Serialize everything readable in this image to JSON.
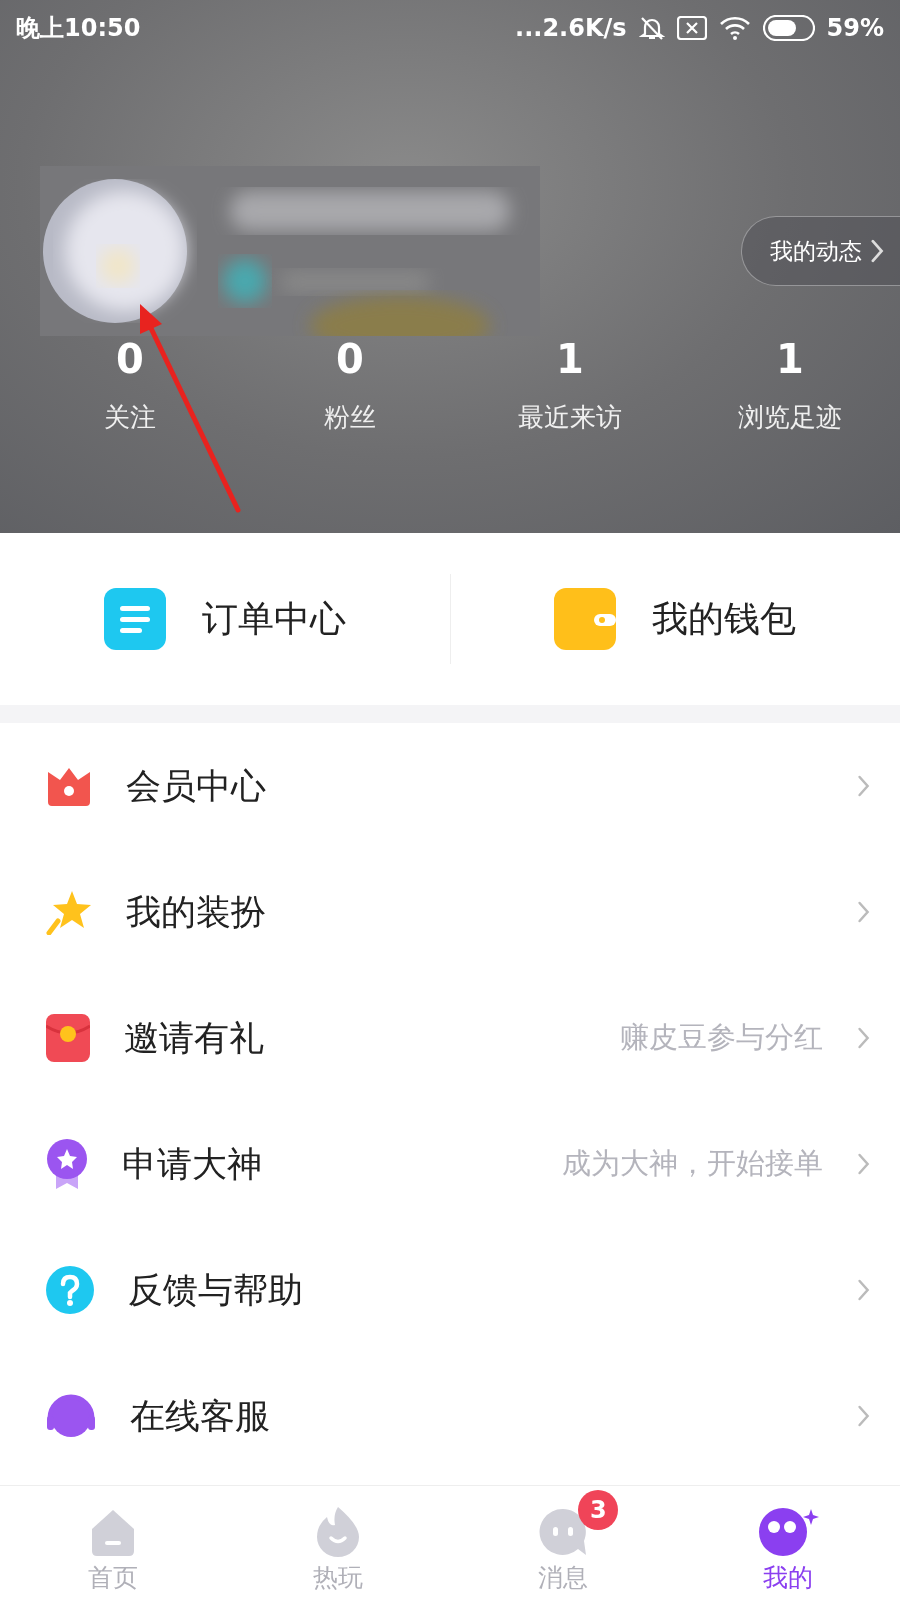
{
  "status_bar": {
    "time": "晚上10:50",
    "network_speed": "...2.6K/s",
    "battery": "59%"
  },
  "profile": {
    "moments_button": "我的动态",
    "stats": [
      {
        "value": "0",
        "label": "关注"
      },
      {
        "value": "0",
        "label": "粉丝"
      },
      {
        "value": "1",
        "label": "最近来访"
      },
      {
        "value": "1",
        "label": "浏览足迹"
      }
    ]
  },
  "shortcuts": [
    {
      "kind": "orders",
      "label": "订单中心",
      "color": "#1ec8f0"
    },
    {
      "kind": "wallet",
      "label": "我的钱包",
      "color": "#ffbf1a"
    }
  ],
  "menu": [
    {
      "kind": "crown",
      "label": "会员中心",
      "color": "#f2554e"
    },
    {
      "kind": "star",
      "label": "我的装扮",
      "color": "#ffc21c"
    },
    {
      "kind": "envelope",
      "label": "邀请有礼",
      "hint": "赚皮豆参与分红",
      "color": "#f04a55"
    },
    {
      "kind": "medal",
      "label": "申请大神",
      "hint": "成为大神，开始接单",
      "color": "#9b55f0"
    },
    {
      "kind": "help",
      "label": "反馈与帮助",
      "color": "#1ec8f0"
    },
    {
      "kind": "headset",
      "label": "在线客服",
      "color": "#9b55f0"
    }
  ],
  "tab_bar": [
    {
      "kind": "home",
      "label": "首页",
      "selected": false
    },
    {
      "kind": "fire",
      "label": "热玩",
      "selected": false
    },
    {
      "kind": "chat",
      "label": "消息",
      "selected": false,
      "badge": "3"
    },
    {
      "kind": "me",
      "label": "我的",
      "selected": true
    }
  ]
}
